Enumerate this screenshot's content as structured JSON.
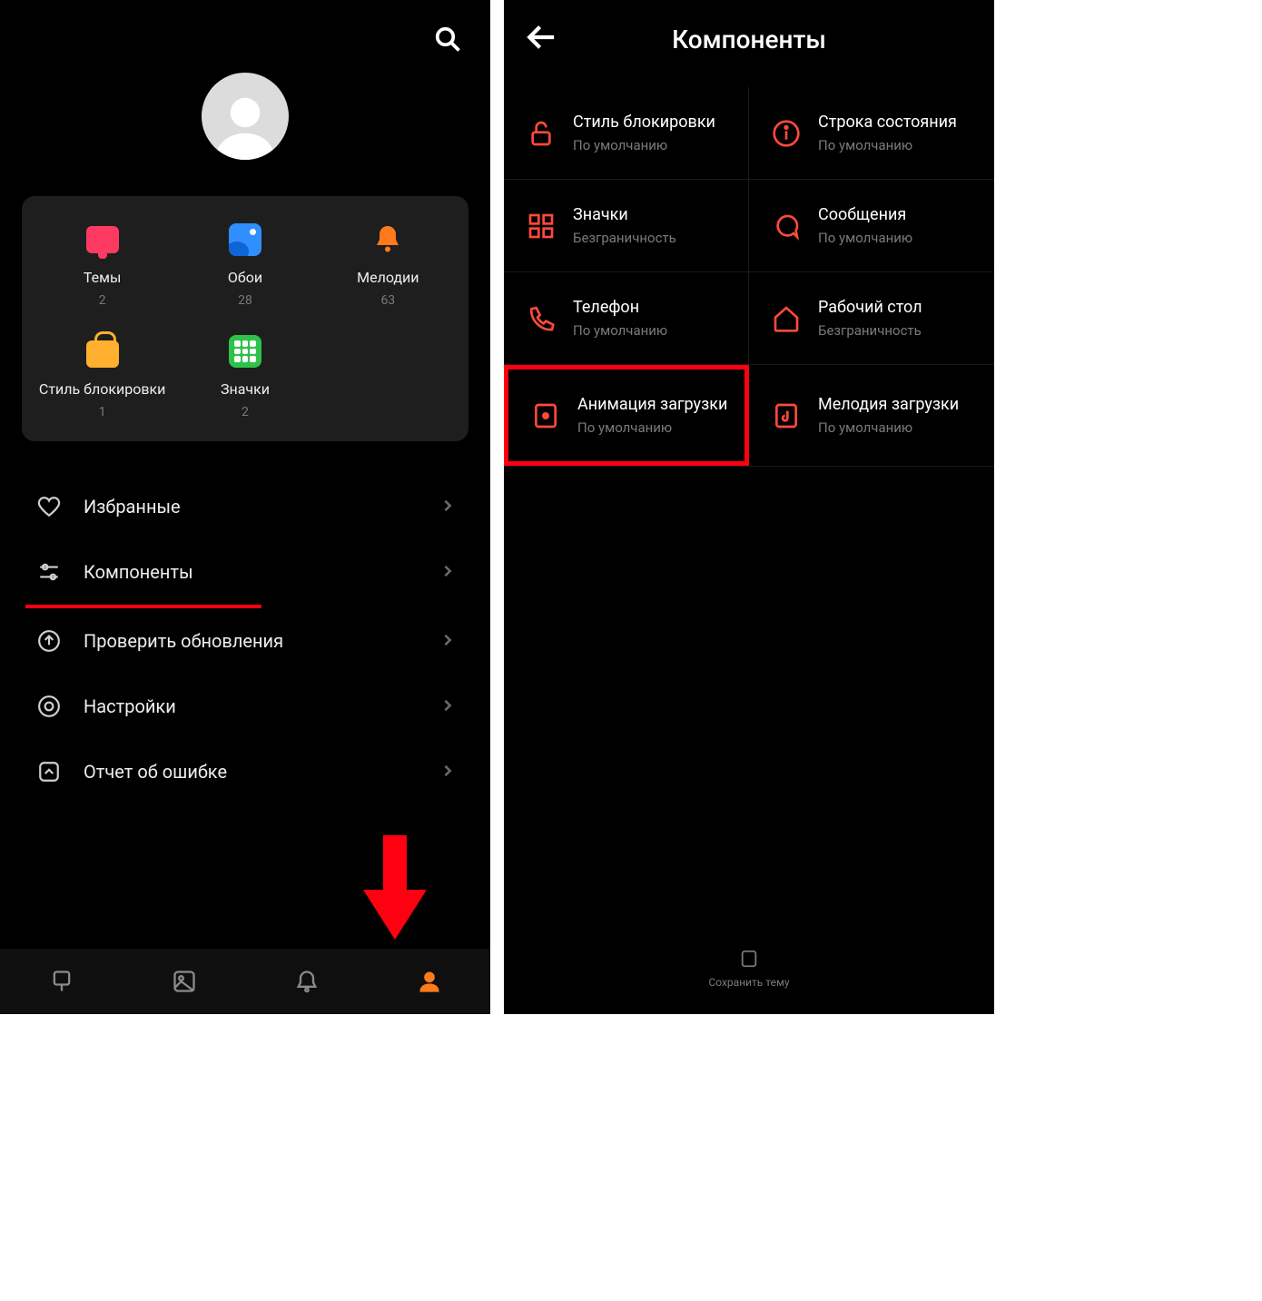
{
  "left": {
    "card": {
      "themes": {
        "label": "Темы",
        "count": "2"
      },
      "wallpapers": {
        "label": "Обои",
        "count": "28"
      },
      "ringtones": {
        "label": "Мелодии",
        "count": "63"
      },
      "lockstyle": {
        "label": "Стиль блокировки",
        "count": "1"
      },
      "icons": {
        "label": "Значки",
        "count": "2"
      }
    },
    "menu": {
      "favorites": "Избранные",
      "components": "Компоненты",
      "check_updates": "Проверить обновления",
      "settings": "Настройки",
      "bug_report": "Отчет об ошибке"
    }
  },
  "right": {
    "title": "Компоненты",
    "save_theme": "Сохранить тему",
    "items": {
      "lockstyle": {
        "title": "Стиль блокировки",
        "sub": "По умолчанию"
      },
      "statusbar": {
        "title": "Строка состояния",
        "sub": "По умолчанию"
      },
      "icons": {
        "title": "Значки",
        "sub": "Безграничность"
      },
      "messages": {
        "title": "Сообщения",
        "sub": "По умолчанию"
      },
      "phone": {
        "title": "Телефон",
        "sub": "По умолчанию"
      },
      "home": {
        "title": "Рабочий стол",
        "sub": "Безграничность"
      },
      "boot_anim": {
        "title": "Анимация загрузки",
        "sub": "По умолчанию"
      },
      "boot_sound": {
        "title": "Мелодия загрузки",
        "sub": "По умолчанию"
      }
    }
  }
}
